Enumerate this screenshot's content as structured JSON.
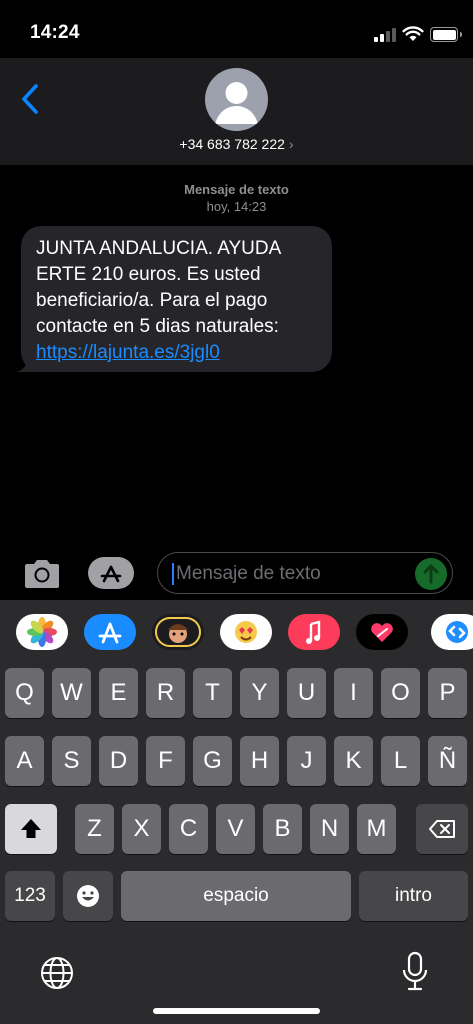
{
  "status_bar": {
    "time": "14:24",
    "signal_bars": 2,
    "battery_level": 1.0
  },
  "header": {
    "contact_number": "+34 683 782 222",
    "contact_chevron": "›",
    "back_icon": "chevron-left-icon",
    "avatar_icon": "person-icon"
  },
  "conversation": {
    "meta_label": "Mensaje de texto",
    "meta_time": "hoy, 14:23",
    "message_text": "JUNTA ANDALUCIA. AYUDA ERTE 210 euros. Es usted beneficiario/a. Para el pago contacte en 5 dias naturales: ",
    "message_link": "https://lajunta.es/3jgl0"
  },
  "input_bar": {
    "placeholder": "Mensaje de texto"
  },
  "app_drawer": [
    "photos-app-icon",
    "app-store-icon",
    "memoji-icon",
    "animoji-icon",
    "music-icon",
    "digital-touch-icon",
    "shazam-icon"
  ],
  "keyboard": {
    "row1": [
      "Q",
      "W",
      "E",
      "R",
      "T",
      "Y",
      "U",
      "I",
      "O",
      "P"
    ],
    "row2": [
      "A",
      "S",
      "D",
      "F",
      "G",
      "H",
      "J",
      "K",
      "L",
      "Ñ"
    ],
    "row3": [
      "Z",
      "X",
      "C",
      "V",
      "B",
      "N",
      "M"
    ],
    "numbers_key": "123",
    "space_key": "espacio",
    "return_key": "intro"
  },
  "colors": {
    "link": "#1a8cff",
    "bubble": "#26252a",
    "header": "#1c1c1e",
    "keyboard": "#2b2b2d",
    "send": "#176b2a"
  }
}
